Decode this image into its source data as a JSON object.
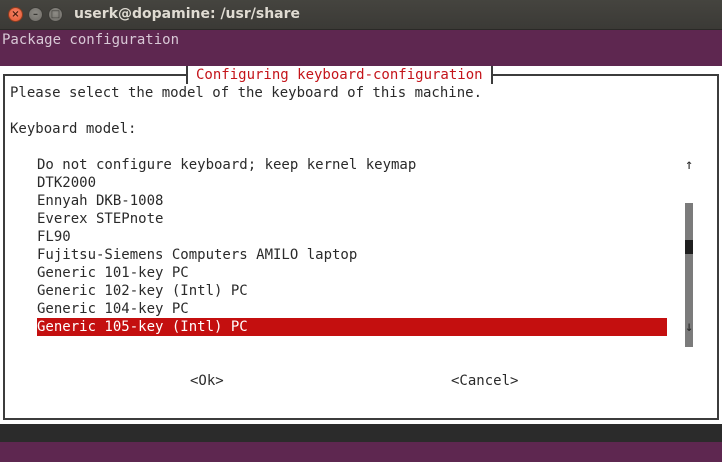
{
  "window": {
    "title": "userk@dopamine: /usr/share"
  },
  "terminal": {
    "backtitle": "Package configuration"
  },
  "dialog": {
    "title": "Configuring keyboard-configuration",
    "prompt": "Please select the model of the keyboard of this machine.",
    "field_label": "Keyboard model:",
    "items": [
      "Do not configure keyboard; keep kernel keymap",
      "DTK2000",
      "Ennyah DKB-1008",
      "Everex STEPnote",
      "FL90",
      "Fujitsu-Siemens Computers AMILO laptop",
      "Generic 101-key PC",
      "Generic 102-key (Intl) PC",
      "Generic 104-key PC",
      "Generic 105-key (Intl) PC"
    ],
    "selected_index": 9,
    "scroll_up": "↑",
    "scroll_down": "↓",
    "ok_label": "<Ok>",
    "cancel_label": "<Cancel>"
  },
  "colors": {
    "terminal_purple": "#5e2750",
    "title_red": "#c4141a",
    "selection_red": "#c40f0f"
  }
}
